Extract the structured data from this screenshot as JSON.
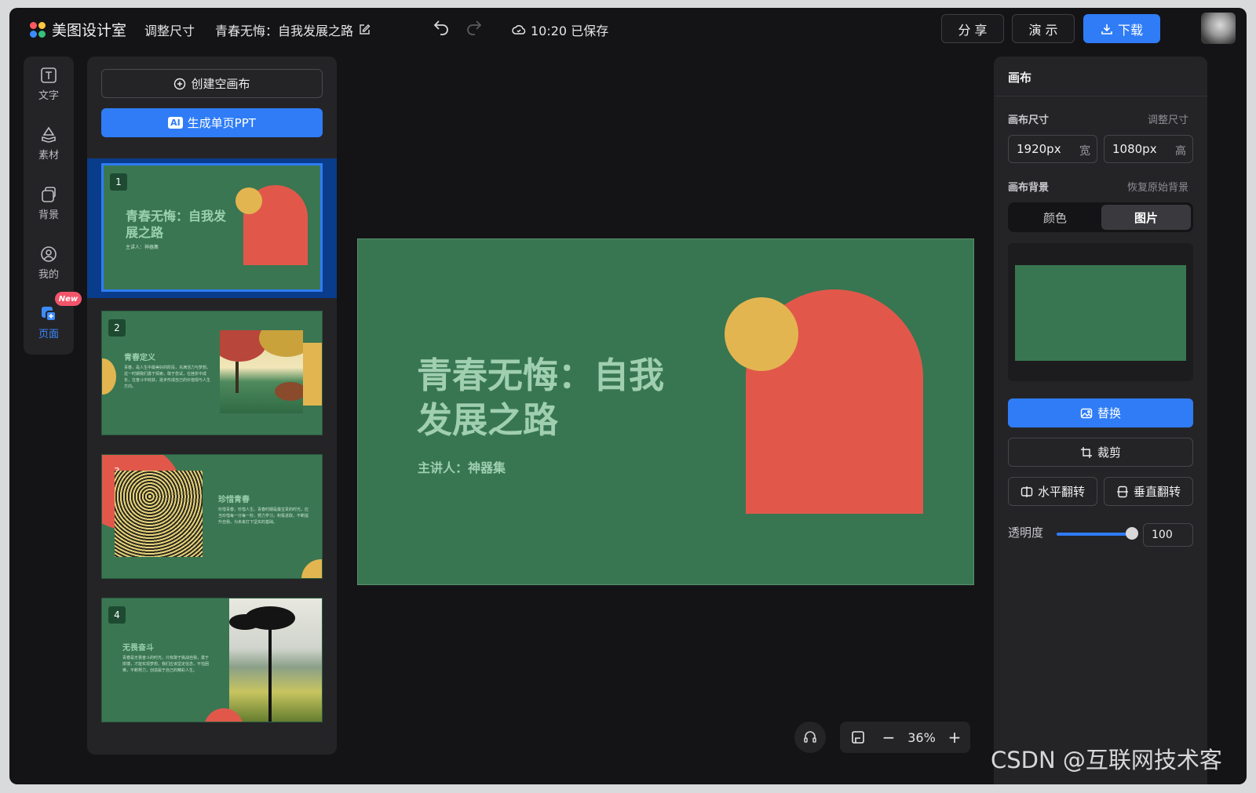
{
  "app": {
    "name": "美图设计室"
  },
  "toolbar": {
    "resize_label": "调整尺寸",
    "doc_title": "青春无悔：自我发展之路",
    "saved_status": "10:20 已保存",
    "share_label": "分 享",
    "present_label": "演 示",
    "download_label": "下载"
  },
  "rail": {
    "items": [
      {
        "label": "文字",
        "icon": "text-icon"
      },
      {
        "label": "素材",
        "icon": "shapes-icon"
      },
      {
        "label": "背景",
        "icon": "background-icon"
      },
      {
        "label": "我的",
        "icon": "user-icon"
      },
      {
        "label": "页面",
        "icon": "pages-icon"
      }
    ],
    "new_badge": "New"
  },
  "pages_panel": {
    "create_label": "创建空画布",
    "ai_chip": "AI",
    "ai_label": "生成单页PPT",
    "thumbs": [
      {
        "num": "1",
        "title": "青春无悔：自我发展之路",
        "sub": "主讲人：神器集"
      },
      {
        "num": "2",
        "title": "青春定义",
        "body": "青春，是人生中最美好的阶段，充满活力与梦想。这一时期我们勇于探索，敢于尝试，在挫折中成长，在奋斗中收获，逐步形成自己的价值观与人生方向。"
      },
      {
        "num": "3",
        "title": "珍惜青春",
        "body": "珍惜青春，珍惜人生。青春时期是最宝贵的时光，应当珍惜每一分每一秒，努力学习，积极进取，不断提升自我，为未来打下坚实的基础。"
      },
      {
        "num": "4",
        "title": "无畏奋斗",
        "body": "青春是无畏奋斗的时光，只有敢于挑战自我，勇于拼搏，才能实现梦想。我们应该坚定信念，不怕困难，不断努力，创造属于自己的精彩人生。"
      }
    ]
  },
  "slide": {
    "title_line1": "青春无悔：自我",
    "title_line2": "发展之路",
    "subtitle": "主讲人：神器集"
  },
  "zoom": {
    "value": "36%"
  },
  "props": {
    "title": "画布",
    "size_label": "画布尺寸",
    "resize_link": "调整尺寸",
    "width_value": "1920px",
    "width_unit": "宽",
    "height_value": "1080px",
    "height_unit": "高",
    "bg_label": "画布背景",
    "reset_link": "恢复原始背景",
    "seg_color": "颜色",
    "seg_image": "图片",
    "replace_label": "替换",
    "crop_label": "裁剪",
    "flip_h_label": "水平翻转",
    "flip_v_label": "垂直翻转",
    "opacity_label": "透明度",
    "opacity_value": "100"
  },
  "watermark": "CSDN @互联网技术客",
  "colors": {
    "accent": "#2f7cf6",
    "slide_bg": "#377651",
    "arch": "#e1584b",
    "sun": "#e3b550"
  }
}
